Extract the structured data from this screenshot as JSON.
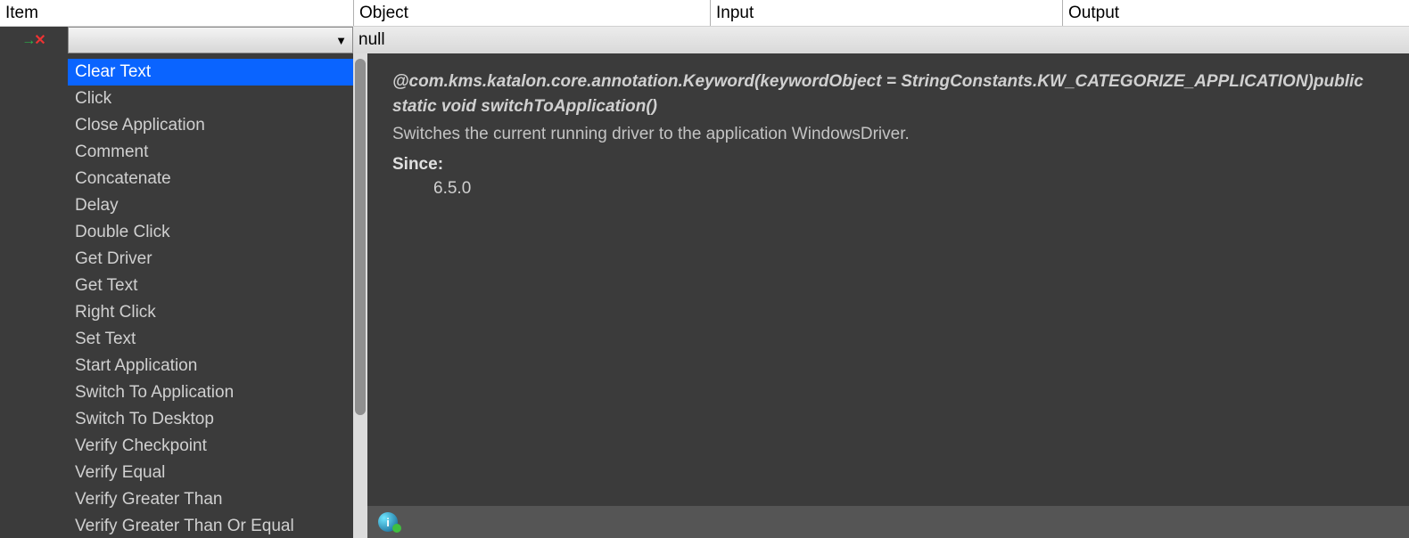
{
  "columns": {
    "item": "Item",
    "object": "Object",
    "input": "Input",
    "output": "Output"
  },
  "row": {
    "object_value": "null"
  },
  "dropdown": {
    "items": [
      "Clear Text",
      "Click",
      "Close Application",
      "Comment",
      "Concatenate",
      "Delay",
      "Double Click",
      "Get Driver",
      "Get Text",
      "Right Click",
      "Set Text",
      "Start Application",
      "Switch To Application",
      "Switch To Desktop",
      "Verify Checkpoint",
      "Verify Equal",
      "Verify Greater Than",
      "Verify Greater Than Or Equal"
    ],
    "selected_index": 0
  },
  "doc": {
    "signature": "@com.kms.katalon.core.annotation.Keyword(keywordObject = StringConstants.KW_CATEGORIZE_APPLICATION)public static void switchToApplication()",
    "description": "Switches the current running driver to the application WindowsDriver.",
    "since_label": "Since:",
    "since_value": "6.5.0"
  }
}
